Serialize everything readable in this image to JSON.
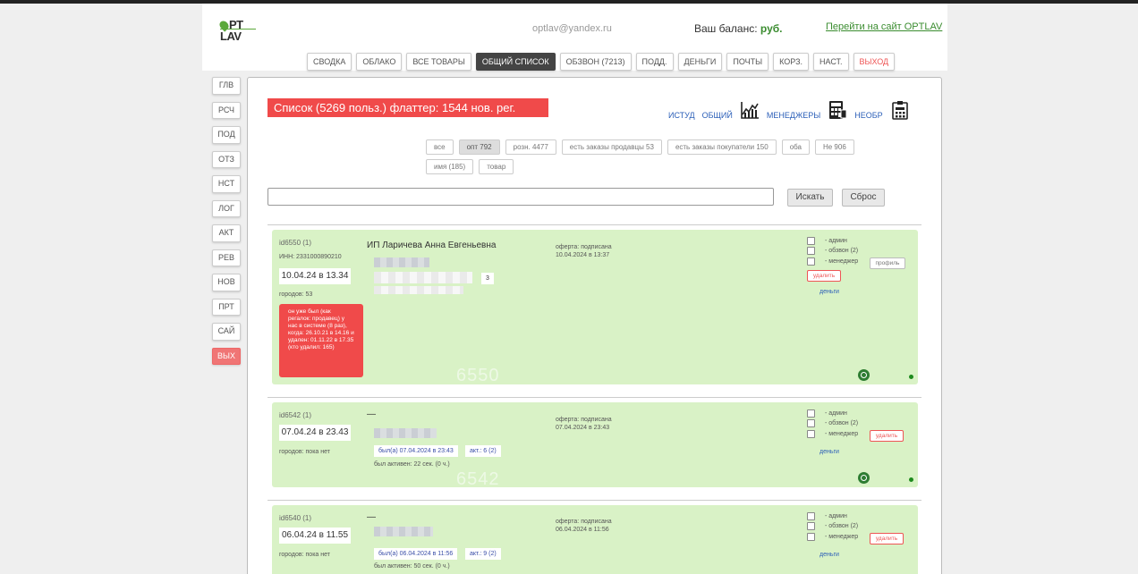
{
  "header": {
    "email": "optlav@yandex.ru",
    "balance_label": "Ваш баланс:",
    "balance_currency": "руб.",
    "site_link": "Перейти на сайт OPTLAV",
    "logo_top": "PT",
    "logo_bottom": "LAV"
  },
  "nav": {
    "items": [
      "СВОДКА",
      "ОБЛАКО",
      "ВСЕ ТОВАРЫ",
      "ОБЩИЙ СПИСОК",
      "ОБЗВОН (7213)",
      "ПОДД.",
      "ДЕНЬГИ",
      "ПОЧТЫ",
      "КОРЗ.",
      "НАСТ.",
      "ВЫХОД"
    ],
    "active_index": 3
  },
  "sidebar": {
    "items": [
      "ГЛВ",
      "РСЧ",
      "ПОД",
      "ОТЗ",
      "НСТ",
      "ЛОГ",
      "АКТ",
      "РЕВ",
      "НОВ",
      "ПРТ",
      "САЙ",
      "ВЫХ"
    ]
  },
  "main": {
    "title": "Список (5269 польз.) флаттер: 1544 нов. рег.",
    "links": [
      "ИСТУД",
      "ОБЩИЙ",
      "МЕНЕДЖЕРЫ",
      "НЕОБР"
    ],
    "filters": [
      "все",
      "опт 792",
      "розн. 4477",
      "есть заказы продавцы 53",
      "есть заказы покупатели 150",
      "оба",
      "Не 906",
      "имя (185)",
      "товар"
    ],
    "selected_filter": 1,
    "search_button": "Искать",
    "reset_button": "Сброс"
  },
  "cards": [
    {
      "id": "id6550 (1)",
      "inn": "ИНН: 2331000890210",
      "date": "10.04.24 в 13.34",
      "cities": "городов: 53",
      "name": "ИП Ларичева Анна Евгеньевна",
      "offer": "оферта: подписана",
      "offer_date": "10.04.2024 в 13:37",
      "count": "3",
      "warning": "он уже был (как регалок: продавец) у нас в системе (8 раз), когда: 26.10.21 в 14.16 и удален: 01.11.22 в 17.35 (кто удалил: 165)",
      "roles": [
        "- админ",
        "- обзвон (2)",
        "- менеджер"
      ],
      "profile_button": "профиль",
      "delete_button": "удалить",
      "money_link": "деньги",
      "watermark": "6550"
    },
    {
      "id": "id6542 (1)",
      "name": "—",
      "date": "07.04.24 в 23.43",
      "cities": "городов: пока нет",
      "offer": "оферта: подписана",
      "offer_date": "07.04.2024 в 23:43",
      "was": "был(а) 07.04.2024 в 23:43",
      "act": "акт.: 6 (2)",
      "active": "был активен: 22 сек. (0 ч.)",
      "roles": [
        "- админ",
        "- обзвон (2)",
        "- менеджер"
      ],
      "delete_button": "удалить",
      "money_link": "деньги",
      "watermark": "6542"
    },
    {
      "id": "id6540 (1)",
      "name": "—",
      "date": "06.04.24 в 11.55",
      "cities": "городов: пока нет",
      "offer": "оферта: подписана",
      "offer_date": "06.04.2024 в 11:56",
      "was": "был(а) 06.04.2024 в 11:56",
      "act": "акт.: 9 (2)",
      "active": "был активен: 50 сек. (0 ч.)",
      "roles": [
        "- админ",
        "- обзвон (2)",
        "- менеджер"
      ],
      "delete_button": "удалить",
      "money_link": "деньги"
    }
  ]
}
